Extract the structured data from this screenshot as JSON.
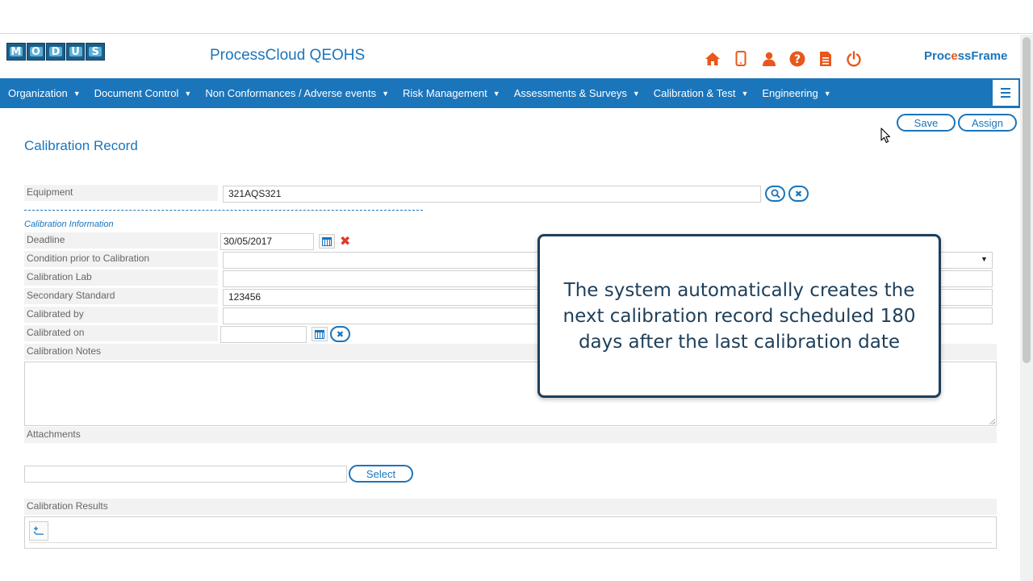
{
  "header": {
    "logo_letters": [
      "M",
      "O",
      "D",
      "U",
      "S"
    ],
    "app_title": "ProcessCloud QEOHS",
    "brand_prefix": "Proc",
    "brand_accent": "e",
    "brand_suffix": "ssFrame",
    "icons": [
      "home-icon",
      "tablet-icon",
      "user-icon",
      "help-icon",
      "document-icon",
      "power-icon"
    ],
    "icon_color": "#e8581c"
  },
  "nav": {
    "items": [
      {
        "label": "Organization"
      },
      {
        "label": "Document Control"
      },
      {
        "label": "Non Conformances / Adverse events"
      },
      {
        "label": "Risk Management"
      },
      {
        "label": "Assessments & Surveys"
      },
      {
        "label": "Calibration & Test"
      },
      {
        "label": "Engineering"
      }
    ],
    "color": "#1b75bb"
  },
  "actions": {
    "save_label": "Save",
    "assign_label": "Assign"
  },
  "form": {
    "title": "Calibration Record",
    "equipment_label": "Equipment",
    "equipment_value": "321AQS321",
    "section_caption": "Calibration Information",
    "deadline_label": "Deadline",
    "deadline_value": "30/05/2017",
    "condition_label": "Condition prior to Calibration",
    "condition_value": "",
    "lab_label": "Calibration Lab",
    "lab_value": "",
    "secondary_label": "Secondary Standard",
    "secondary_value": "123456",
    "calibrated_by_label": "Calibrated by",
    "calibrated_by_value": "",
    "calibrated_on_label": "Calibrated on",
    "calibrated_on_value": "",
    "notes_label": "Calibration Notes",
    "attachments_label": "Attachments",
    "select_label": "Select",
    "results_label": "Calibration Results"
  },
  "overlay": {
    "message": "The system automatically creates the next calibration record scheduled 180 days after the last calibration date"
  }
}
